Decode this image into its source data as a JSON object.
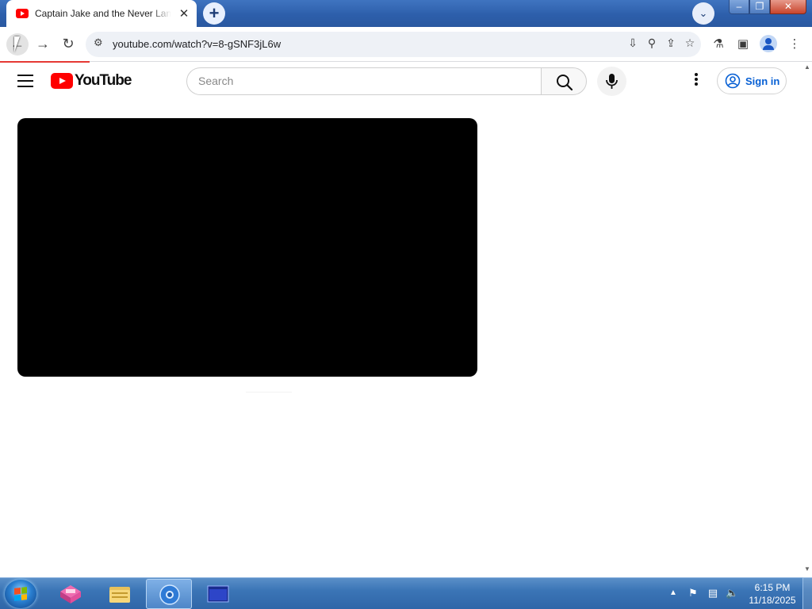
{
  "browser": {
    "tab": {
      "title": "Captain Jake and the Never Land Pirates",
      "close": "✕"
    },
    "new_tab": "+",
    "tab_search": "⌄",
    "window": {
      "minimize": "–",
      "maximize": "❐",
      "close": "✕"
    },
    "nav": {
      "back": "←",
      "forward": "→",
      "reload": "↻"
    },
    "address": {
      "url": "youtube.com/watch?v=8-gSNF3jL6w",
      "site_info": "⚙"
    },
    "omnibox_icons": {
      "install": "⇩",
      "zoom": "⚲",
      "share": "⇪",
      "bookmark": "☆"
    },
    "toolbar_icons": {
      "labs": "⚗",
      "side_panel": "▣",
      "menu": "⋮"
    },
    "progress_fraction": 0.11
  },
  "youtube": {
    "logo_text": "YouTube",
    "search": {
      "placeholder": "Search"
    },
    "sign_in": "Sign in"
  },
  "taskbar": {
    "clock": {
      "time": "6:15 PM",
      "date": "11/18/2025"
    },
    "tray_arrow": "▲",
    "apps": [
      "network-gateway-app",
      "file-explorer",
      "chrome-browser",
      "media-window"
    ]
  },
  "colors": {
    "youtube_red": "#ff0000",
    "link_blue": "#065fd4",
    "taskbar_blue": "#3b75b6"
  }
}
